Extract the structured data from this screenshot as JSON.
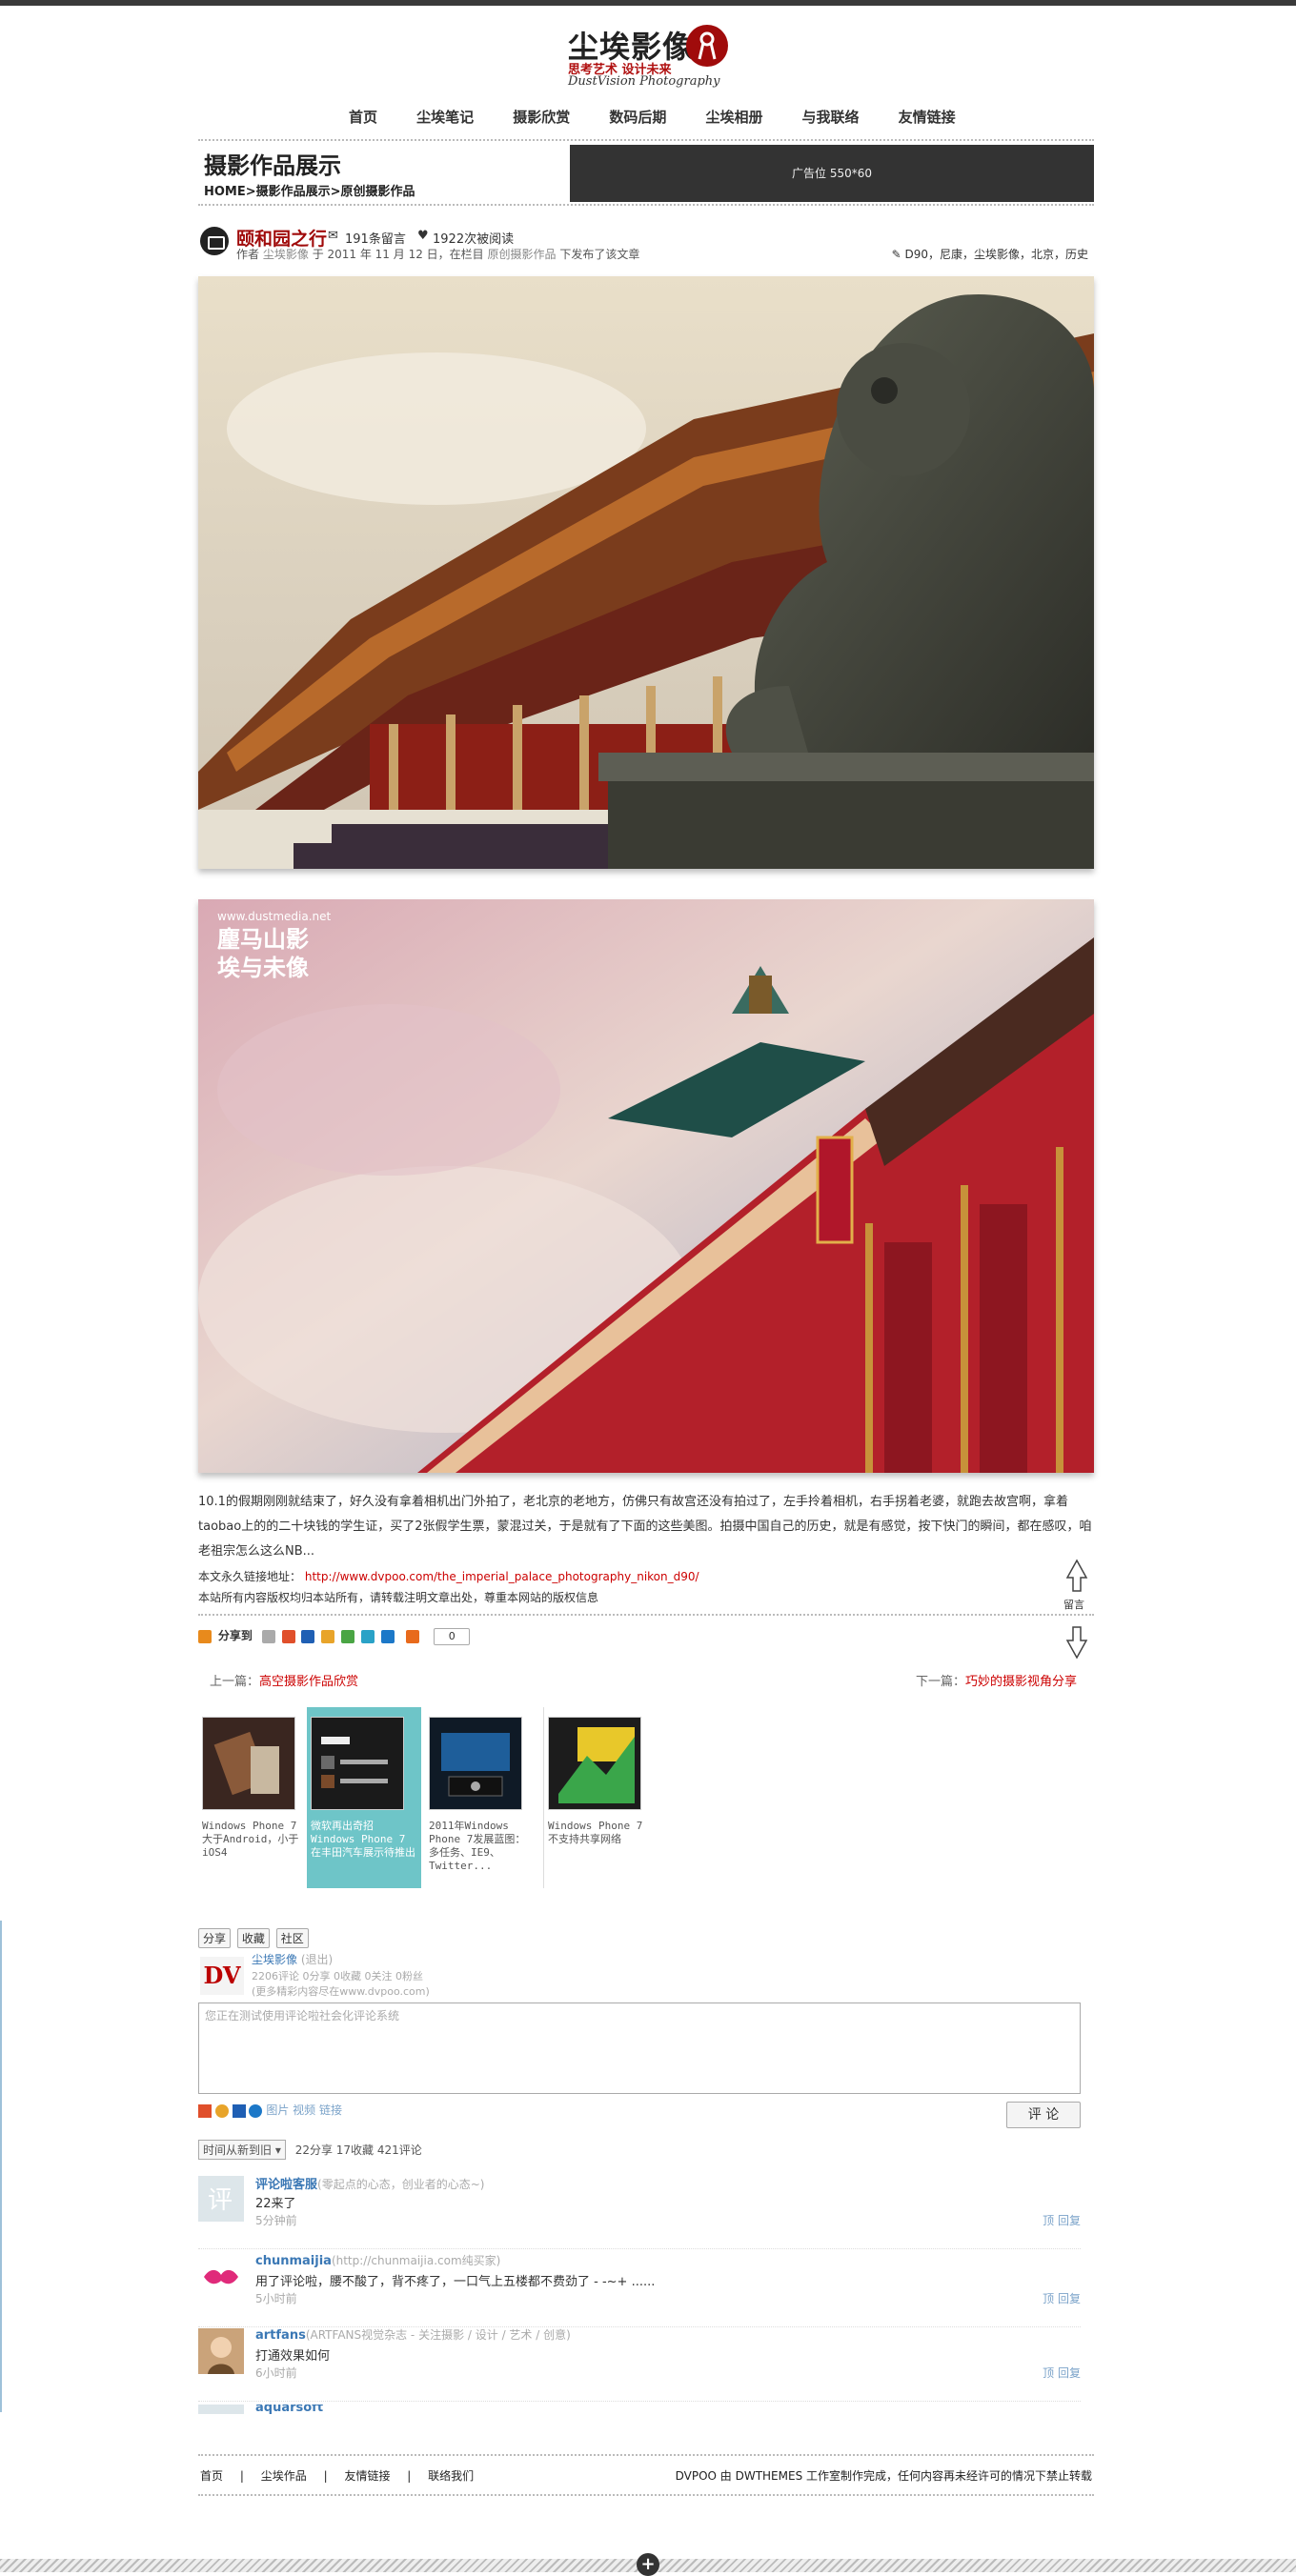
{
  "site": {
    "logo_cn": "尘埃影像",
    "motto": "思考艺术 设计未来",
    "logo_en": "DustVision Photography"
  },
  "nav": [
    "首页",
    "尘埃笔记",
    "摄影欣赏",
    "数码后期",
    "尘埃相册",
    "与我联络",
    "友情链接"
  ],
  "pagehead": {
    "title": "摄影作品展示",
    "crumb": "HOME>摄影作品展示>原创摄影作品",
    "ad": "广告位 550*60"
  },
  "post": {
    "title": "颐和园之行",
    "comments": "191条留言",
    "reads": "1922次被阅读",
    "byline_pre": "作者",
    "author": "尘埃影像",
    "date": "于 2011 年 11 月 12 日，在栏目",
    "category": "原创摄影作品",
    "byline_post": "下发布了该文章",
    "tags": "D90，尼康，尘埃影像，北京，历史",
    "watermark_url": "www.dustmedia.net",
    "watermark_cn1": "麈马山影",
    "watermark_cn2": "埃与未像"
  },
  "article": {
    "body": "10.1的假期刚刚就结束了，好久没有拿着相机出门外拍了，老北京的老地方，仿佛只有故宫还没有拍过了，左手拎着相机，右手拐着老婆，就跑去故宫啊，拿着taobao上的的二十块钱的学生证，买了2张假学生票，蒙混过关，于是就有了下面的这些美图。拍摄中国自己的历史，就是有感觉，按下快门的瞬间，都在感叹，咱老祖宗怎么这么NB...",
    "perm_label": "本文永久链接地址：",
    "perm_url": "http://www.dvpoo.com/the_imperial_palace_photography_nikon_d90/",
    "copyright": "本站所有内容版权均归本站所有，请转载注明文章出处，尊重本网站的版权信息",
    "share_label": "分享到",
    "share_count": "0",
    "side_label": "留言",
    "prev_label": "上一篇：",
    "prev_title": "高空摄影作品欣赏",
    "next_label": "下一篇：",
    "next_title": "巧妙的摄影视角分享"
  },
  "related": [
    {
      "caption": "Windows Phone 7 大于Android，小于iOS4"
    },
    {
      "caption": "微软再出奇招 Windows Phone 7 在丰田汽车展示待推出"
    },
    {
      "caption": "2011年Windows Phone 7发展蓝图：多任务、IE9、Twitter..."
    },
    {
      "caption": "Windows Phone 7 不支持共享网络"
    }
  ],
  "comments": {
    "tools": [
      "分享",
      "收藏",
      "社区"
    ],
    "user_name": "尘埃影像",
    "user_logout": "(退出)",
    "user_stats": "2206评论 0分享 0收藏 0关注 0粉丝",
    "user_site": "(更多精彩内容尽在www.dvpoo.com)",
    "box_placeholder": "您正在测试使用评论啦社会化评论系统",
    "attach": "图片 视频 链接",
    "submit": "评 论",
    "sort": "时间从新到旧",
    "summary": "22分享 17收藏 421评论",
    "items": [
      {
        "name": "评论啦客服",
        "sub": "(零起点的心态，创业者的心态~)",
        "text": "22来了",
        "time": "5分钟前",
        "actions": "顶 回复"
      },
      {
        "name": "chunmaijia",
        "sub": "(http://chunmaijia.com纯买家)",
        "text": "用了评论啦，腰不酸了，背不疼了，一口气上五楼都不费劲了 - -~+ ......",
        "time": "5小时前",
        "actions": "顶 回复"
      },
      {
        "name": "artfans",
        "sub": "(ARTFANS视觉杂志 - 关注摄影 / 设计 / 艺术 / 创意)",
        "text": "打通效果如何",
        "time": "6小时前",
        "actions": "顶 回复"
      },
      {
        "name": "aquarsoft",
        "sub": "",
        "text": "",
        "time": "",
        "actions": ""
      }
    ]
  },
  "footer": {
    "links": [
      "首页",
      "|",
      "尘埃作品",
      "|",
      "友情链接",
      "|",
      "联络我们"
    ],
    "copy": "DVPOO 由 DWTHEMES 工作室制作完成，任何内容再未经许可的情况下禁止转载"
  },
  "colors": {
    "accent": "#a00b0b",
    "link_blue": "#3b78b5",
    "teal": "#6ec5c8"
  }
}
